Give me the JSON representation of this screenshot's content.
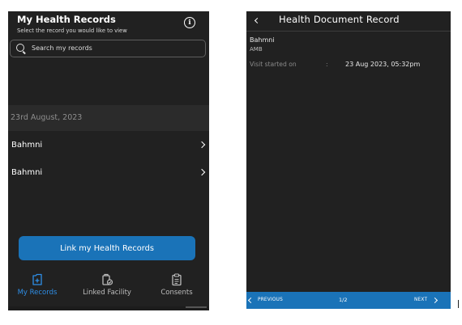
{
  "left": {
    "header": {
      "title": "My Health Records",
      "subtitle": "Select the record you would like to view"
    },
    "search": {
      "placeholder": "Search my records",
      "value": ""
    },
    "date_group": "23rd August, 2023",
    "records": [
      {
        "label": "Bahmni"
      },
      {
        "label": "Bahmni"
      }
    ],
    "link_button": "Link my Health Records",
    "nav": [
      {
        "label": "My Records",
        "icon": "records-icon",
        "active": true
      },
      {
        "label": "Linked Facility",
        "icon": "facility-icon",
        "active": false
      },
      {
        "label": "Consents",
        "icon": "consents-icon",
        "active": false
      }
    ]
  },
  "right": {
    "header": {
      "title": "Health Document Record"
    },
    "provider": {
      "name": "Bahmni",
      "type": "AMB"
    },
    "visit": {
      "label": "Visit started on",
      "separator": ":",
      "value": "23 Aug 2023, 05:32pm"
    },
    "pager": {
      "previous": "PREVIOUS",
      "page": "1/2",
      "next": "NEXT"
    }
  },
  "colors": {
    "background": "#212121",
    "accent": "#1a73b8",
    "active_nav": "#2e8ee6"
  }
}
